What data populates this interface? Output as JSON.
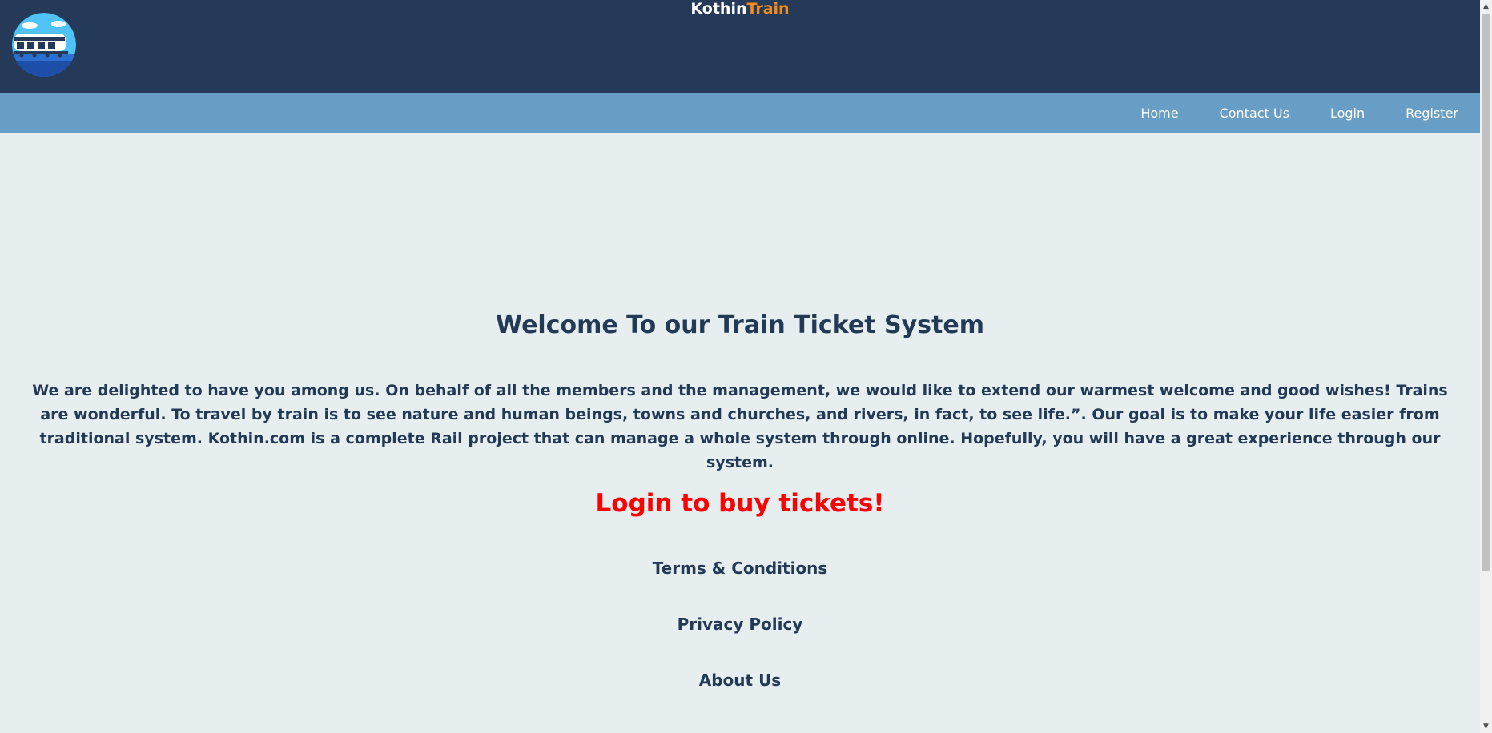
{
  "header": {
    "brand_part1": "Kothin",
    "brand_part2": "Train",
    "logo_icon": "train-logo-icon"
  },
  "nav": {
    "items": [
      {
        "label": "Home"
      },
      {
        "label": "Contact Us"
      },
      {
        "label": "Login"
      },
      {
        "label": "Register"
      }
    ]
  },
  "main": {
    "welcome_title": "Welcome To our Train Ticket System",
    "intro_text": "We are delighted to have you among us. On behalf of all the members and the management, we would like to extend our warmest welcome and good wishes! Trains are wonderful. To travel by train is to see nature and human beings, towns and churches, and rivers, in fact, to see life.”. Our goal is to make your life easier from traditional system. Kothin.com is a complete Rail project that can manage a whole system through online. Hopefully, you will have a great experience through our system.",
    "cta_text": "Login to buy tickets!"
  },
  "footer_links": {
    "terms": "Terms & Conditions",
    "privacy": "Privacy Policy",
    "about": "About Us"
  },
  "colors": {
    "header_bg": "#253a58",
    "nav_bg": "#689ec6",
    "page_bg": "#e6eef0",
    "text": "#233a57",
    "accent": "#f28c1e",
    "cta": "#ff0000"
  }
}
